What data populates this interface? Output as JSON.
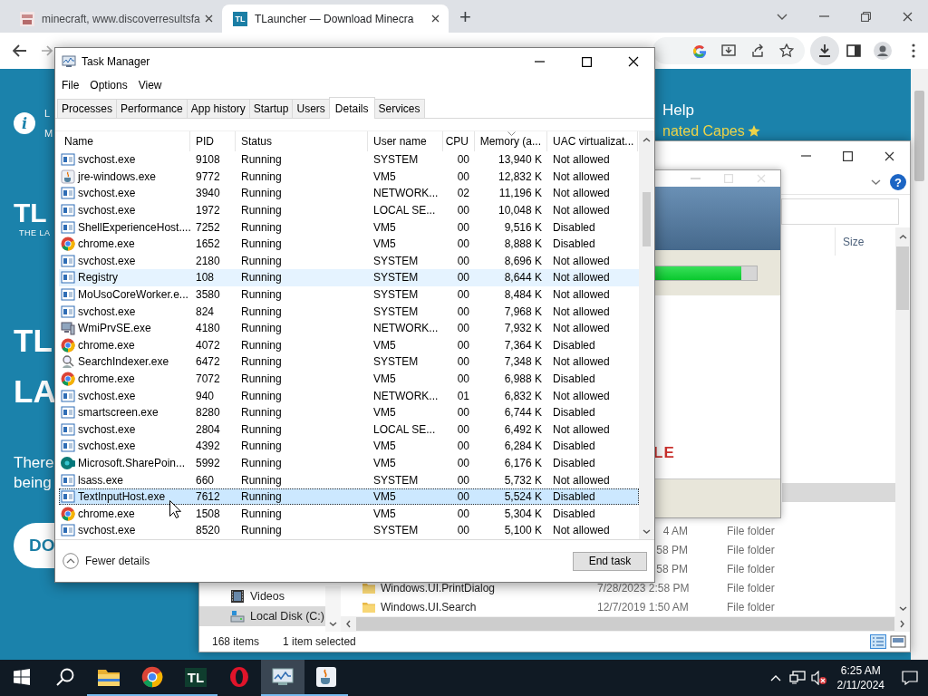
{
  "browser": {
    "tabs": [
      {
        "title": "minecraft, www.discoverresultsfa",
        "selected": false
      },
      {
        "title": "TLauncher — Download Minecra",
        "selected": true,
        "favicon_text": "TL"
      }
    ],
    "new_tab": "+"
  },
  "website": {
    "info_glyph": "i",
    "info_lines": [
      "L",
      "M"
    ],
    "logo": "TL",
    "logo_sub": "THE LA",
    "headline": [
      "TL",
      "LA"
    ],
    "paragraph": [
      "There",
      "being"
    ],
    "button": "DO",
    "nav_link": "Help",
    "promo": "nated Capes"
  },
  "explorer": {
    "help_glyph": "?",
    "columns": [
      "Size"
    ],
    "rows": [
      {
        "selected": true
      },
      {
        "selected": false
      },
      {
        "kind": "partial",
        "date": "4 AM",
        "type": "File folder",
        "selected": false
      },
      {
        "kind": "partial",
        "date": "58 PM",
        "type": "File folder",
        "selected": false
      },
      {
        "kind": "partial",
        "date": "58 PM",
        "type": "File folder",
        "selected": false
      },
      {
        "kind": "full",
        "name": "Windows.UI.PrintDialog",
        "date": "7/28/2023 2:58 PM",
        "type": "File folder",
        "selected": false
      },
      {
        "kind": "full",
        "name": "Windows.UI.Search",
        "date": "12/7/2019 1:50 AM",
        "type": "File folder",
        "selected": false
      }
    ],
    "nav": [
      {
        "label": "Videos",
        "kind": "video",
        "selected": false
      },
      {
        "label": "Local Disk (C:)",
        "kind": "disk",
        "selected": true
      }
    ],
    "status": [
      "168 items",
      "1 item selected"
    ]
  },
  "installer": {
    "level": 0.85,
    "brand": "LE"
  },
  "task_manager": {
    "title": "Task Manager",
    "menu": [
      "File",
      "Options",
      "View"
    ],
    "tabs": [
      {
        "label": "Processes",
        "selected": false
      },
      {
        "label": "Performance",
        "selected": false
      },
      {
        "label": "App history",
        "selected": false
      },
      {
        "label": "Startup",
        "selected": false
      },
      {
        "label": "Users",
        "selected": false
      },
      {
        "label": "Details",
        "selected": true
      },
      {
        "label": "Services",
        "selected": false
      }
    ],
    "columns": [
      {
        "label": "Name",
        "sorted": false
      },
      {
        "label": "PID",
        "sorted": false
      },
      {
        "label": "Status",
        "sorted": false
      },
      {
        "label": "User name",
        "sorted": false
      },
      {
        "label": "CPU",
        "sorted": false
      },
      {
        "label": "Memory (a...",
        "sorted": true
      },
      {
        "label": "UAC virtualizat...",
        "sorted": false
      }
    ],
    "rows": [
      {
        "name": "svchost.exe",
        "kind": "service",
        "pid": "9108",
        "status": "Running",
        "user": "SYSTEM",
        "cpu": "00",
        "memory": "13,940 K",
        "uac": "Not allowed",
        "selected": false,
        "highlighted": false
      },
      {
        "name": "jre-windows.exe",
        "kind": "java",
        "pid": "9772",
        "status": "Running",
        "user": "VM5",
        "cpu": "00",
        "memory": "12,832 K",
        "uac": "Not allowed",
        "selected": false,
        "highlighted": false
      },
      {
        "name": "svchost.exe",
        "kind": "service",
        "pid": "3940",
        "status": "Running",
        "user": "NETWORK...",
        "cpu": "02",
        "memory": "11,196 K",
        "uac": "Not allowed",
        "selected": false,
        "highlighted": false
      },
      {
        "name": "svchost.exe",
        "kind": "service",
        "pid": "1972",
        "status": "Running",
        "user": "LOCAL SE...",
        "cpu": "00",
        "memory": "10,048 K",
        "uac": "Not allowed",
        "selected": false,
        "highlighted": false
      },
      {
        "name": "ShellExperienceHost....",
        "kind": "service",
        "pid": "7252",
        "status": "Running",
        "user": "VM5",
        "cpu": "00",
        "memory": "9,516 K",
        "uac": "Disabled",
        "selected": false,
        "highlighted": false
      },
      {
        "name": "chrome.exe",
        "kind": "chrome",
        "pid": "1652",
        "status": "Running",
        "user": "VM5",
        "cpu": "00",
        "memory": "8,888 K",
        "uac": "Disabled",
        "selected": false,
        "highlighted": false
      },
      {
        "name": "svchost.exe",
        "kind": "service",
        "pid": "2180",
        "status": "Running",
        "user": "SYSTEM",
        "cpu": "00",
        "memory": "8,696 K",
        "uac": "Not allowed",
        "selected": false,
        "highlighted": false
      },
      {
        "name": "Registry",
        "kind": "service",
        "pid": "108",
        "status": "Running",
        "user": "SYSTEM",
        "cpu": "00",
        "memory": "8,644 K",
        "uac": "Not allowed",
        "selected": false,
        "highlighted": true
      },
      {
        "name": "MoUsoCoreWorker.e...",
        "kind": "service",
        "pid": "3580",
        "status": "Running",
        "user": "SYSTEM",
        "cpu": "00",
        "memory": "8,484 K",
        "uac": "Not allowed",
        "selected": false,
        "highlighted": false
      },
      {
        "name": "svchost.exe",
        "kind": "service",
        "pid": "824",
        "status": "Running",
        "user": "SYSTEM",
        "cpu": "00",
        "memory": "7,968 K",
        "uac": "Not allowed",
        "selected": false,
        "highlighted": false
      },
      {
        "name": "WmiPrvSE.exe",
        "kind": "wmi",
        "pid": "4180",
        "status": "Running",
        "user": "NETWORK...",
        "cpu": "00",
        "memory": "7,932 K",
        "uac": "Not allowed",
        "selected": false,
        "highlighted": false
      },
      {
        "name": "chrome.exe",
        "kind": "chrome",
        "pid": "4072",
        "status": "Running",
        "user": "VM5",
        "cpu": "00",
        "memory": "7,364 K",
        "uac": "Disabled",
        "selected": false,
        "highlighted": false
      },
      {
        "name": "SearchIndexer.exe",
        "kind": "search",
        "pid": "6472",
        "status": "Running",
        "user": "SYSTEM",
        "cpu": "00",
        "memory": "7,348 K",
        "uac": "Not allowed",
        "selected": false,
        "highlighted": false
      },
      {
        "name": "chrome.exe",
        "kind": "chrome",
        "pid": "7072",
        "status": "Running",
        "user": "VM5",
        "cpu": "00",
        "memory": "6,988 K",
        "uac": "Disabled",
        "selected": false,
        "highlighted": false
      },
      {
        "name": "svchost.exe",
        "kind": "service",
        "pid": "940",
        "status": "Running",
        "user": "NETWORK...",
        "cpu": "01",
        "memory": "6,832 K",
        "uac": "Not allowed",
        "selected": false,
        "highlighted": false
      },
      {
        "name": "smartscreen.exe",
        "kind": "service",
        "pid": "8280",
        "status": "Running",
        "user": "VM5",
        "cpu": "00",
        "memory": "6,744 K",
        "uac": "Disabled",
        "selected": false,
        "highlighted": false
      },
      {
        "name": "svchost.exe",
        "kind": "service",
        "pid": "2804",
        "status": "Running",
        "user": "LOCAL SE...",
        "cpu": "00",
        "memory": "6,492 K",
        "uac": "Not allowed",
        "selected": false,
        "highlighted": false
      },
      {
        "name": "svchost.exe",
        "kind": "service",
        "pid": "4392",
        "status": "Running",
        "user": "VM5",
        "cpu": "00",
        "memory": "6,284 K",
        "uac": "Disabled",
        "selected": false,
        "highlighted": false
      },
      {
        "name": "Microsoft.SharePoin...",
        "kind": "sharepoint",
        "pid": "5992",
        "status": "Running",
        "user": "VM5",
        "cpu": "00",
        "memory": "6,176 K",
        "uac": "Disabled",
        "selected": false,
        "highlighted": false
      },
      {
        "name": "lsass.exe",
        "kind": "service",
        "pid": "660",
        "status": "Running",
        "user": "SYSTEM",
        "cpu": "00",
        "memory": "5,732 K",
        "uac": "Not allowed",
        "selected": false,
        "highlighted": false
      },
      {
        "name": "TextInputHost.exe",
        "kind": "service",
        "pid": "7612",
        "status": "Running",
        "user": "VM5",
        "cpu": "00",
        "memory": "5,524 K",
        "uac": "Disabled",
        "selected": true,
        "highlighted": false
      },
      {
        "name": "chrome.exe",
        "kind": "chrome",
        "pid": "1508",
        "status": "Running",
        "user": "VM5",
        "cpu": "00",
        "memory": "5,304 K",
        "uac": "Disabled",
        "selected": false,
        "highlighted": false
      },
      {
        "name": "svchost.exe",
        "kind": "service",
        "pid": "8520",
        "status": "Running",
        "user": "SYSTEM",
        "cpu": "00",
        "memory": "5,100 K",
        "uac": "Not allowed",
        "selected": false,
        "highlighted": false
      }
    ],
    "footer": {
      "toggle": "Fewer details",
      "button": "End task"
    }
  },
  "taskbar": {
    "apps": [
      {
        "kind": "folder",
        "running": true,
        "active": false
      },
      {
        "kind": "chrome",
        "running": true,
        "active": false
      },
      {
        "kind": "text",
        "label": "TL",
        "running": true,
        "active": false
      },
      {
        "kind": "opera",
        "running": false,
        "active": false
      },
      {
        "kind": "taskmgr",
        "running": true,
        "active": true
      },
      {
        "kind": "java",
        "running": true,
        "active": false
      }
    ],
    "time": "6:25 AM",
    "date": "2/11/2024"
  }
}
